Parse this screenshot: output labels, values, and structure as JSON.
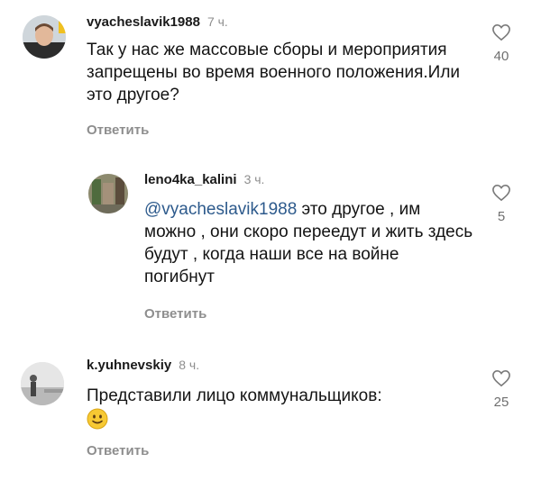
{
  "comments": [
    {
      "username": "vyacheslavik1988",
      "time": "7 ч.",
      "text": "Так у нас же массовые сборы и мероприятия запрещены во время военного положения.Или это другое?",
      "reply_label": "Ответить",
      "likes": "40",
      "avatar_icon": "user-avatar-photo"
    },
    {
      "username": "leno4ka_kalini",
      "time": "3 ч.",
      "mention": "@vyacheslavik1988",
      "text": " это другое , им можно , они скоро переедут и жить здесь будут , когда наши все на войне погибнут",
      "reply_label": "Ответить",
      "likes": "5",
      "avatar_icon": "user-avatar-photo"
    },
    {
      "username": "k.yuhnevskiy",
      "time": "8 ч.",
      "text": "Представили лицо коммунальщиков:",
      "emoji": "slightly-smiling-face-emoji",
      "reply_label": "Ответить",
      "likes": "25",
      "avatar_icon": "user-avatar-photo"
    }
  ],
  "colors": {
    "mention": "#2d5a8c",
    "muted": "#8e8e8e"
  },
  "icons": {
    "like": "heart-outline-icon"
  }
}
